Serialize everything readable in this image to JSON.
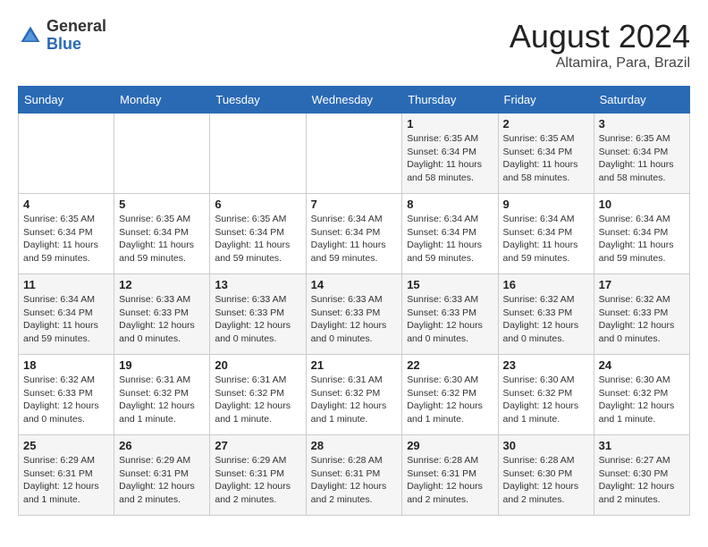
{
  "header": {
    "logo_general": "General",
    "logo_blue": "Blue",
    "title": "August 2024",
    "location": "Altamira, Para, Brazil"
  },
  "days_of_week": [
    "Sunday",
    "Monday",
    "Tuesday",
    "Wednesday",
    "Thursday",
    "Friday",
    "Saturday"
  ],
  "weeks": [
    [
      {
        "day": "",
        "info": ""
      },
      {
        "day": "",
        "info": ""
      },
      {
        "day": "",
        "info": ""
      },
      {
        "day": "",
        "info": ""
      },
      {
        "day": "1",
        "info": "Sunrise: 6:35 AM\nSunset: 6:34 PM\nDaylight: 11 hours\nand 58 minutes."
      },
      {
        "day": "2",
        "info": "Sunrise: 6:35 AM\nSunset: 6:34 PM\nDaylight: 11 hours\nand 58 minutes."
      },
      {
        "day": "3",
        "info": "Sunrise: 6:35 AM\nSunset: 6:34 PM\nDaylight: 11 hours\nand 58 minutes."
      }
    ],
    [
      {
        "day": "4",
        "info": "Sunrise: 6:35 AM\nSunset: 6:34 PM\nDaylight: 11 hours\nand 59 minutes."
      },
      {
        "day": "5",
        "info": "Sunrise: 6:35 AM\nSunset: 6:34 PM\nDaylight: 11 hours\nand 59 minutes."
      },
      {
        "day": "6",
        "info": "Sunrise: 6:35 AM\nSunset: 6:34 PM\nDaylight: 11 hours\nand 59 minutes."
      },
      {
        "day": "7",
        "info": "Sunrise: 6:34 AM\nSunset: 6:34 PM\nDaylight: 11 hours\nand 59 minutes."
      },
      {
        "day": "8",
        "info": "Sunrise: 6:34 AM\nSunset: 6:34 PM\nDaylight: 11 hours\nand 59 minutes."
      },
      {
        "day": "9",
        "info": "Sunrise: 6:34 AM\nSunset: 6:34 PM\nDaylight: 11 hours\nand 59 minutes."
      },
      {
        "day": "10",
        "info": "Sunrise: 6:34 AM\nSunset: 6:34 PM\nDaylight: 11 hours\nand 59 minutes."
      }
    ],
    [
      {
        "day": "11",
        "info": "Sunrise: 6:34 AM\nSunset: 6:34 PM\nDaylight: 11 hours\nand 59 minutes."
      },
      {
        "day": "12",
        "info": "Sunrise: 6:33 AM\nSunset: 6:33 PM\nDaylight: 12 hours\nand 0 minutes."
      },
      {
        "day": "13",
        "info": "Sunrise: 6:33 AM\nSunset: 6:33 PM\nDaylight: 12 hours\nand 0 minutes."
      },
      {
        "day": "14",
        "info": "Sunrise: 6:33 AM\nSunset: 6:33 PM\nDaylight: 12 hours\nand 0 minutes."
      },
      {
        "day": "15",
        "info": "Sunrise: 6:33 AM\nSunset: 6:33 PM\nDaylight: 12 hours\nand 0 minutes."
      },
      {
        "day": "16",
        "info": "Sunrise: 6:32 AM\nSunset: 6:33 PM\nDaylight: 12 hours\nand 0 minutes."
      },
      {
        "day": "17",
        "info": "Sunrise: 6:32 AM\nSunset: 6:33 PM\nDaylight: 12 hours\nand 0 minutes."
      }
    ],
    [
      {
        "day": "18",
        "info": "Sunrise: 6:32 AM\nSunset: 6:33 PM\nDaylight: 12 hours\nand 0 minutes."
      },
      {
        "day": "19",
        "info": "Sunrise: 6:31 AM\nSunset: 6:32 PM\nDaylight: 12 hours\nand 1 minute."
      },
      {
        "day": "20",
        "info": "Sunrise: 6:31 AM\nSunset: 6:32 PM\nDaylight: 12 hours\nand 1 minute."
      },
      {
        "day": "21",
        "info": "Sunrise: 6:31 AM\nSunset: 6:32 PM\nDaylight: 12 hours\nand 1 minute."
      },
      {
        "day": "22",
        "info": "Sunrise: 6:30 AM\nSunset: 6:32 PM\nDaylight: 12 hours\nand 1 minute."
      },
      {
        "day": "23",
        "info": "Sunrise: 6:30 AM\nSunset: 6:32 PM\nDaylight: 12 hours\nand 1 minute."
      },
      {
        "day": "24",
        "info": "Sunrise: 6:30 AM\nSunset: 6:32 PM\nDaylight: 12 hours\nand 1 minute."
      }
    ],
    [
      {
        "day": "25",
        "info": "Sunrise: 6:29 AM\nSunset: 6:31 PM\nDaylight: 12 hours\nand 1 minute."
      },
      {
        "day": "26",
        "info": "Sunrise: 6:29 AM\nSunset: 6:31 PM\nDaylight: 12 hours\nand 2 minutes."
      },
      {
        "day": "27",
        "info": "Sunrise: 6:29 AM\nSunset: 6:31 PM\nDaylight: 12 hours\nand 2 minutes."
      },
      {
        "day": "28",
        "info": "Sunrise: 6:28 AM\nSunset: 6:31 PM\nDaylight: 12 hours\nand 2 minutes."
      },
      {
        "day": "29",
        "info": "Sunrise: 6:28 AM\nSunset: 6:31 PM\nDaylight: 12 hours\nand 2 minutes."
      },
      {
        "day": "30",
        "info": "Sunrise: 6:28 AM\nSunset: 6:30 PM\nDaylight: 12 hours\nand 2 minutes."
      },
      {
        "day": "31",
        "info": "Sunrise: 6:27 AM\nSunset: 6:30 PM\nDaylight: 12 hours\nand 2 minutes."
      }
    ]
  ]
}
